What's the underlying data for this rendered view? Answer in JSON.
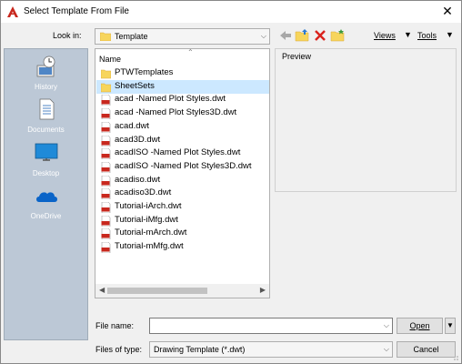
{
  "window": {
    "title": "Select Template From File"
  },
  "toolbar": {
    "look_in_label": "Look in:",
    "look_in_value": "Template",
    "views_label": "Views",
    "tools_label": "Tools"
  },
  "places": [
    {
      "label": "History",
      "icon": "history-icon"
    },
    {
      "label": "Documents",
      "icon": "documents-icon"
    },
    {
      "label": "Desktop",
      "icon": "desktop-icon"
    },
    {
      "label": "OneDrive",
      "icon": "onedrive-icon"
    }
  ],
  "file_list": {
    "column_header": "Name",
    "items": [
      {
        "name": "PTWTemplates",
        "type": "folder"
      },
      {
        "name": "SheetSets",
        "type": "folder",
        "selected": true
      },
      {
        "name": "acad -Named Plot Styles.dwt",
        "type": "dwt"
      },
      {
        "name": "acad -Named Plot Styles3D.dwt",
        "type": "dwt"
      },
      {
        "name": "acad.dwt",
        "type": "dwt"
      },
      {
        "name": "acad3D.dwt",
        "type": "dwt"
      },
      {
        "name": "acadISO -Named Plot Styles.dwt",
        "type": "dwt"
      },
      {
        "name": "acadISO -Named Plot Styles3D.dwt",
        "type": "dwt"
      },
      {
        "name": "acadiso.dwt",
        "type": "dwt"
      },
      {
        "name": "acadiso3D.dwt",
        "type": "dwt"
      },
      {
        "name": "Tutorial-iArch.dwt",
        "type": "dwt"
      },
      {
        "name": "Tutorial-iMfg.dwt",
        "type": "dwt"
      },
      {
        "name": "Tutorial-mArch.dwt",
        "type": "dwt"
      },
      {
        "name": "Tutorial-mMfg.dwt",
        "type": "dwt"
      }
    ]
  },
  "preview": {
    "label": "Preview"
  },
  "footer": {
    "file_name_label": "File name:",
    "file_name_value": "",
    "files_of_type_label": "Files of type:",
    "files_of_type_value": "Drawing Template (*.dwt)",
    "open_label": "Open",
    "cancel_label": "Cancel"
  },
  "colors": {
    "folder": "#f7d55c",
    "selection": "#cce8ff",
    "places_bg": "#bcc8d6",
    "delete": "#d9231d",
    "dwt_red": "#c8281e"
  }
}
